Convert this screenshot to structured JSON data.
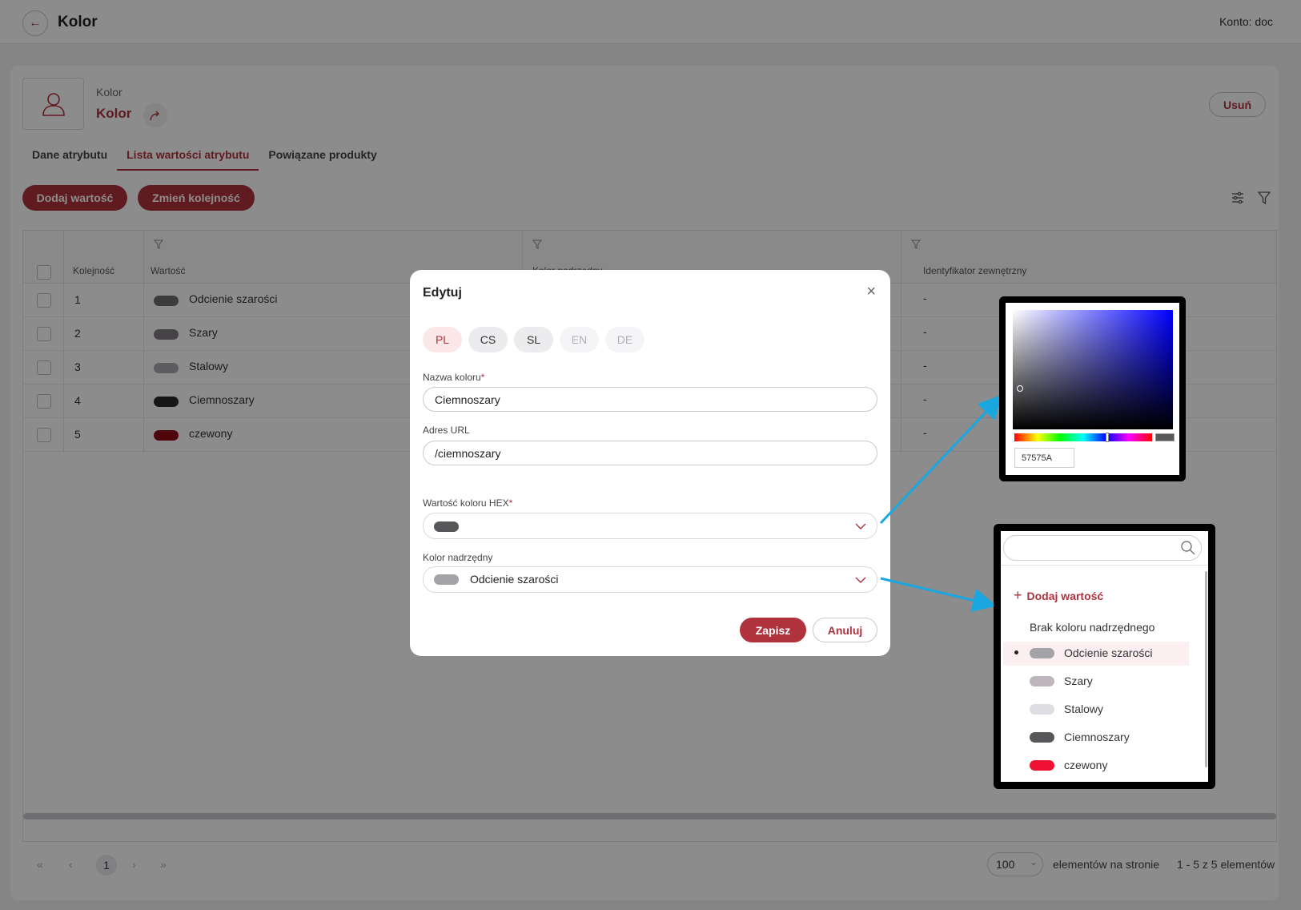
{
  "topbar": {
    "title": "Kolor",
    "account": "Konto: doc"
  },
  "header": {
    "subtitle": "Kolor",
    "title": "Kolor",
    "delete_label": "Usuń"
  },
  "tabs": [
    {
      "label": "Dane atrybutu"
    },
    {
      "label": "Lista wartości atrybutu"
    },
    {
      "label": "Powiązane produkty"
    }
  ],
  "toolbar": {
    "add_label": "Dodaj wartość",
    "reorder_label": "Zmień kolejność"
  },
  "table": {
    "columns": [
      "Kolejność",
      "Wartość",
      "Kolor nadrzędny",
      "Identyfikator zewnętrzny"
    ],
    "rows": [
      {
        "order": "1",
        "value": "Odcienie szarości",
        "color": "#6e6e72",
        "external": "-"
      },
      {
        "order": "2",
        "value": "Szary",
        "color": "#7f7b80",
        "external": "-"
      },
      {
        "order": "3",
        "value": "Stalowy",
        "color": "#a9a9ad",
        "external": "-"
      },
      {
        "order": "4",
        "value": "Ciemnoszary",
        "color": "#2b2b2d",
        "external": "-"
      },
      {
        "order": "5",
        "value": "czewony",
        "color": "#8e0a18",
        "external": "-"
      }
    ]
  },
  "pagination": {
    "current_page": "1",
    "page_size": "100",
    "per_page_label": "elementów na stronie",
    "range_label": "1 - 5 z 5 elementów"
  },
  "modal": {
    "title": "Edytuj",
    "languages": [
      {
        "code": "PL",
        "state": "active"
      },
      {
        "code": "CS",
        "state": "normal"
      },
      {
        "code": "SL",
        "state": "normal"
      },
      {
        "code": "EN",
        "state": "disabled"
      },
      {
        "code": "DE",
        "state": "disabled"
      }
    ],
    "name_label": "Nazwa koloru",
    "name_value": "Ciemnoszary",
    "url_label": "Adres URL",
    "url_value": "/ciemnoszary",
    "hex_label": "Wartość koloru HEX",
    "hex_color": "#57575a",
    "parent_label": "Kolor nadrzędny",
    "parent_value": "Odcienie szarości",
    "parent_color": "#a3a3a8",
    "required_mark": "*",
    "save_label": "Zapisz",
    "cancel_label": "Anuluj"
  },
  "color_picker": {
    "hex_value": "57575A",
    "hue_color": "#0000ff"
  },
  "parent_dropdown": {
    "add_label": "Dodaj wartość",
    "none_label": "Brak koloru nadrzędnego",
    "options": [
      {
        "label": "Odcienie szarości",
        "color": "#a3a3a8",
        "selected": true
      },
      {
        "label": "Szary",
        "color": "#bdb7bd",
        "selected": false
      },
      {
        "label": "Stalowy",
        "color": "#dedee2",
        "selected": false
      },
      {
        "label": "Ciemnoszary",
        "color": "#57575a",
        "selected": false
      },
      {
        "label": "czewony",
        "color": "#ee1133",
        "selected": false
      }
    ]
  },
  "colors": {
    "accent": "#b0323d",
    "callout_arrow": "#1aa7e0"
  }
}
